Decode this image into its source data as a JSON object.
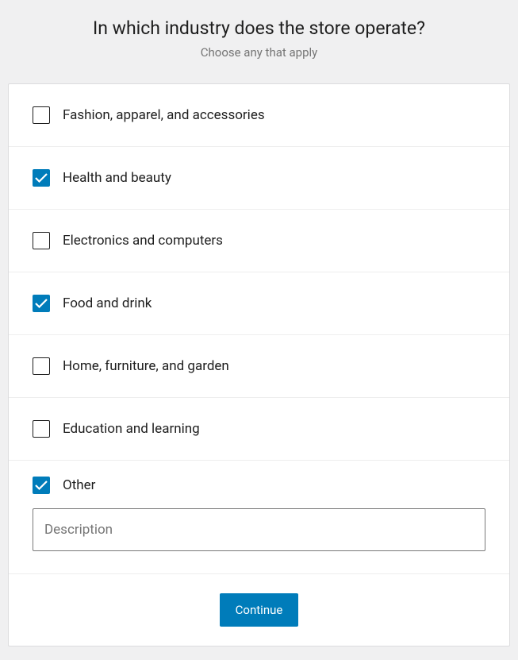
{
  "header": {
    "title": "In which industry does the store operate?",
    "subtitle": "Choose any that apply"
  },
  "options": [
    {
      "label": "Fashion, apparel, and accessories",
      "checked": false
    },
    {
      "label": "Health and beauty",
      "checked": true
    },
    {
      "label": "Electronics and computers",
      "checked": false
    },
    {
      "label": "Food and drink",
      "checked": true
    },
    {
      "label": "Home, furniture, and garden",
      "checked": false
    },
    {
      "label": "Education and learning",
      "checked": false
    }
  ],
  "other": {
    "label": "Other",
    "checked": true,
    "placeholder": "Description",
    "value": ""
  },
  "footer": {
    "continue_label": "Continue"
  }
}
